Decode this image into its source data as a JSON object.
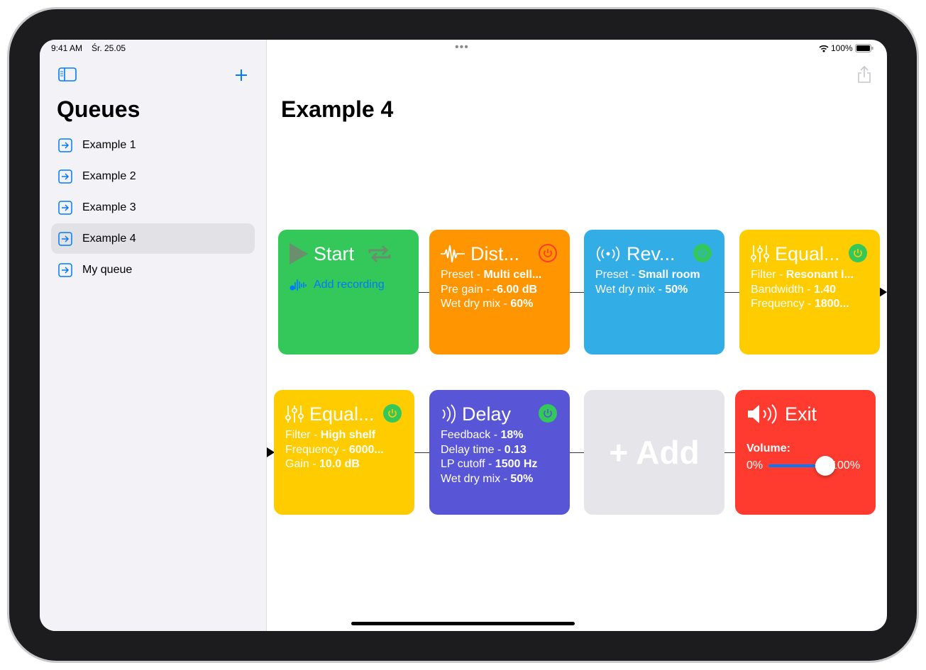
{
  "status": {
    "time": "9:41 AM",
    "date": "Śr. 25.05",
    "battery": "100%"
  },
  "sidebar": {
    "title": "Queues",
    "items": [
      {
        "label": "Example 1"
      },
      {
        "label": "Example 2"
      },
      {
        "label": "Example 3"
      },
      {
        "label": "Example 4",
        "selected": true
      },
      {
        "label": "My queue"
      }
    ]
  },
  "main": {
    "title": "Example 4"
  },
  "cards": {
    "start": {
      "title": "Start",
      "add_recording": "Add recording"
    },
    "dist": {
      "title": "Dist...",
      "l1k": "Preset - ",
      "l1v": "Multi cell...",
      "l2k": "Pre gain - ",
      "l2v": "-6.00 dB",
      "l3k": "Wet dry mix - ",
      "l3v": "60%"
    },
    "rev": {
      "title": "Rev...",
      "l1k": "Preset - ",
      "l1v": "Small room",
      "l2k": "Wet dry mix - ",
      "l2v": "50%"
    },
    "eq1": {
      "title": "Equal...",
      "l1k": "Filter - ",
      "l1v": "Resonant l...",
      "l2k": "Bandwidth - ",
      "l2v": "1.40",
      "l3k": "Frequency - ",
      "l3v": "1800..."
    },
    "eq2": {
      "title": "Equal...",
      "l1k": "Filter - ",
      "l1v": "High shelf",
      "l2k": "Frequency - ",
      "l2v": "6000...",
      "l3k": "Gain - ",
      "l3v": "10.0 dB"
    },
    "delay": {
      "title": "Delay",
      "l1k": "Feedback - ",
      "l1v": "18%",
      "l2k": "Delay time - ",
      "l2v": "0.13",
      "l3k": "LP cutoff - ",
      "l3v": "1500 Hz",
      "l4k": "Wet dry mix - ",
      "l4v": "50%"
    },
    "add": {
      "title": "+ Add"
    },
    "exit": {
      "title": "Exit",
      "volume_label": "Volume:",
      "min": "0%",
      "max": "100%",
      "volume": 1.0
    }
  },
  "colors": {
    "green": "#34c759",
    "orange": "#ff9500",
    "blue": "#32ade6",
    "yellow": "#ffcc00",
    "indigo": "#5856d6",
    "gray": "#e5e5ea",
    "red": "#ff3b30",
    "accent": "#007aff"
  }
}
